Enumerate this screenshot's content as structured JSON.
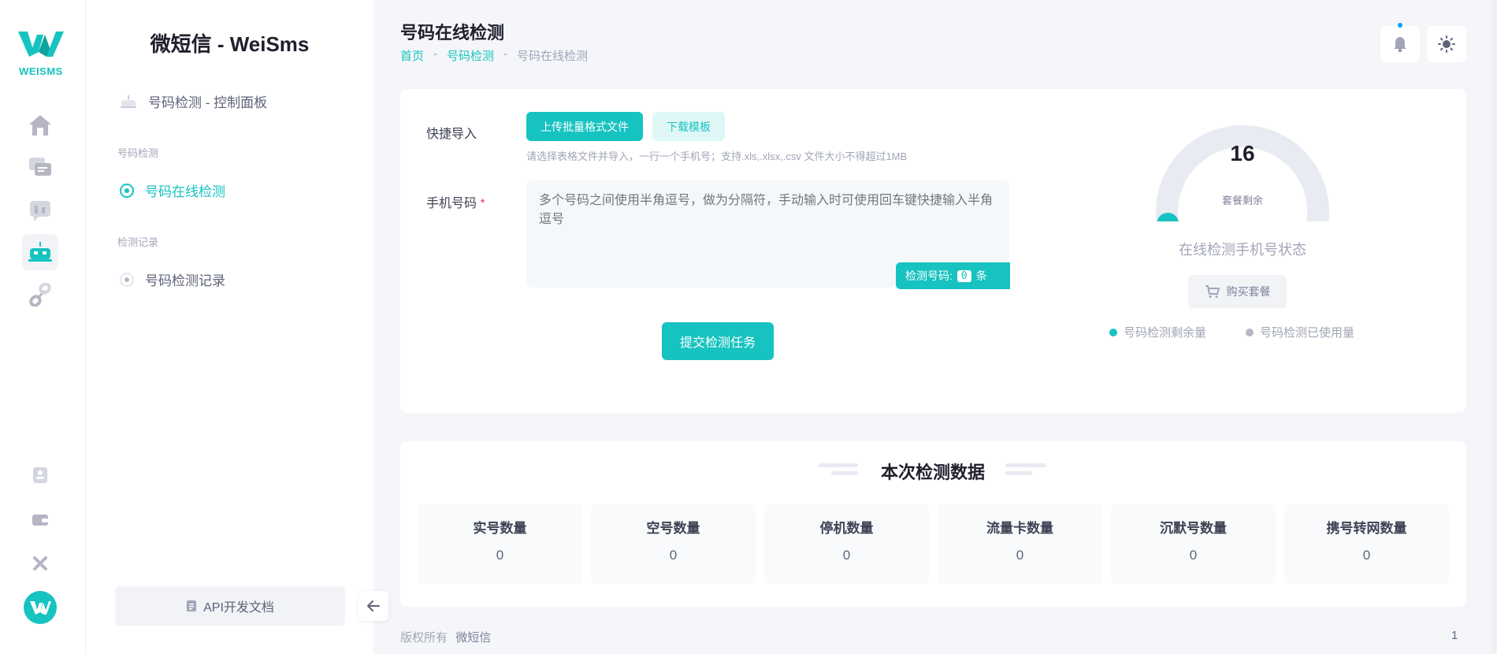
{
  "brand": {
    "logo_text": "WEISMS",
    "title": "微短信 - WeiSms"
  },
  "sidebar": {
    "dashboard": "号码检测 - 控制面板",
    "section1": "号码检测",
    "item_online": "号码在线检测",
    "section2": "检测记录",
    "item_records": "号码检测记录",
    "api_docs": "API开发文档"
  },
  "header": {
    "title": "号码在线检测",
    "crumbs": [
      "首页",
      "号码检测",
      "号码在线检测"
    ],
    "sep": "-"
  },
  "form": {
    "import_label": "快捷导入",
    "upload_btn": "上传批量格式文件",
    "template_btn": "下载模板",
    "import_hint": "请选择表格文件并导入，一行一个手机号；支持.xls,.xlsx,.csv 文件大小不得超过1MB",
    "phone_label": "手机号码",
    "required_mark": "*",
    "phone_placeholder": "多个号码之间使用半角逗号，做为分隔符，手动输入时可使用回车键快捷输入半角逗号",
    "count_label": "检测号码:",
    "count_value": "0",
    "count_unit": "条",
    "submit_btn": "提交检测任务"
  },
  "gauge": {
    "value": "16",
    "sub": "套餐剩余",
    "remaining_fraction": 0.05,
    "status": "在线检测手机号状态",
    "buy_btn": "购买套餐",
    "legend_remaining": "号码检测剩余量",
    "legend_used": "号码检测已使用量"
  },
  "colors": {
    "accent": "#16c3c0",
    "used": "#b5b5c3",
    "track": "#e9ebf2"
  },
  "stats": {
    "title": "本次检测数据",
    "items": [
      {
        "label": "实号数量",
        "value": "0"
      },
      {
        "label": "空号数量",
        "value": "0"
      },
      {
        "label": "停机数量",
        "value": "0"
      },
      {
        "label": "流量卡数量",
        "value": "0"
      },
      {
        "label": "沉默号数量",
        "value": "0"
      },
      {
        "label": "携号转网数量",
        "value": "0"
      }
    ]
  },
  "footer": {
    "copyright": "版权所有",
    "company": "微短信",
    "page": "1"
  }
}
